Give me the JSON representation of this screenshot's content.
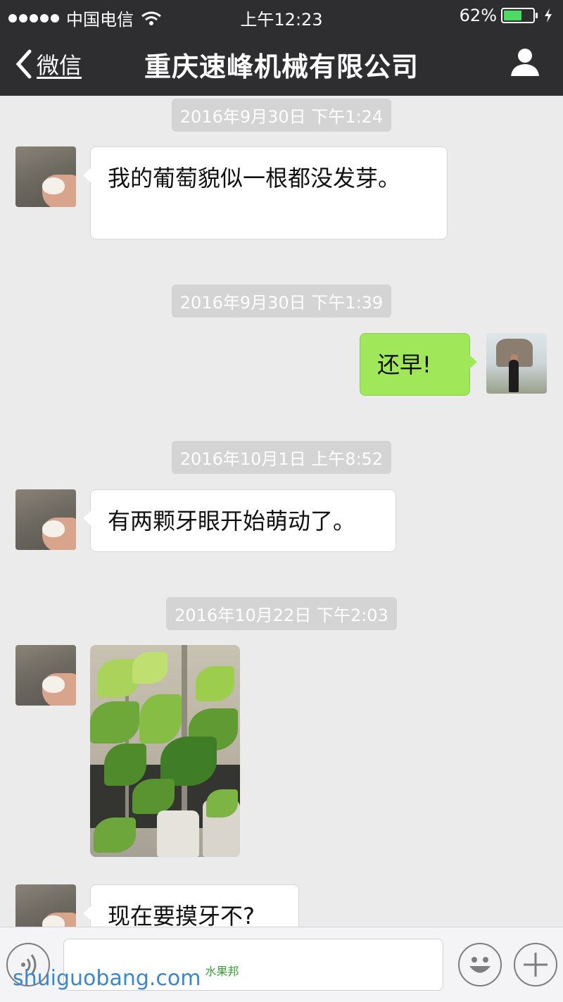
{
  "status_bar": {
    "carrier": "中国电信",
    "time": "上午12:23",
    "battery_percent": "62%",
    "battery_level": 0.62,
    "icons": [
      "signal-dots-icon",
      "wifi-icon",
      "battery-icon",
      "charging-bolt-icon"
    ]
  },
  "nav": {
    "back_label": "微信",
    "title": "重庆速峰机械有限公司",
    "profile_icon": "person-icon"
  },
  "messages": {
    "ts1": "2016年9月30日 下午1:24",
    "m1": "我的葡萄貌似一根都没发芽。",
    "ts2": "2016年9月30日 下午1:39",
    "m2": "还早!",
    "ts3": "2016年10月1日 上午8:52",
    "m3": "有两颗牙眼开始萌动了。",
    "ts4": "2016年10月22日 下午2:03",
    "m4_image": "grape-seedling-photo",
    "m5": "现在要摸牙不?"
  },
  "input_bar": {
    "icons": [
      "voice-icon",
      "emoji-icon",
      "plus-icon"
    ]
  },
  "watermark": {
    "text": "shuiguobang.com",
    "sub": "水果邦"
  },
  "colors": {
    "nav_bg": "#2e2e31",
    "chat_bg": "#ebebeb",
    "sent_bubble": "#a0e75a",
    "received_bubble": "#ffffff"
  }
}
